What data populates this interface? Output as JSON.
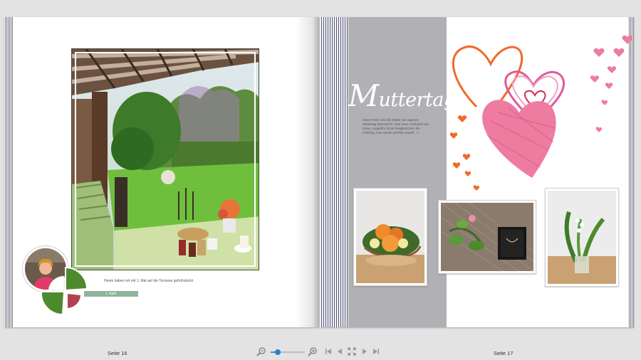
{
  "book": {
    "left_page": {
      "caption": "Heute haben wir mit 1. Mal auf die Terrasse gefrühstückt.",
      "date_label": "1. April",
      "page_label": "Seite 16"
    },
    "right_page": {
      "title_cap": "M",
      "title_rest": "uttertag",
      "body_text": "Hans Peter und die Kinder am eigenen Muttertag überrascht. Das neue Armband von Klara. Ungefähr Ende Maiglöckchen bis Frühling, was wieder perfekt erstellt. ☺",
      "page_label": "Seite 17"
    }
  },
  "toolbar": {
    "zoom_out_icon": "zoom-out-icon",
    "zoom_in_icon": "zoom-in-icon",
    "zoom_level": 0.2,
    "first_page_icon": "first-page-icon",
    "prev_page_icon": "prev-page-icon",
    "fit_icon": "fit-view-icon",
    "next_page_icon": "next-page-icon",
    "last_page_icon": "last-page-icon"
  },
  "colors": {
    "background": "#e3e3e3",
    "gray_band": "#b1b1b5",
    "clover_green": "#4d8a2c",
    "clover_red": "#b2424f",
    "heart_pink": "#ee7ba0",
    "heart_orange": "#ef6a2a",
    "accent_blue": "#2d7fd0"
  }
}
